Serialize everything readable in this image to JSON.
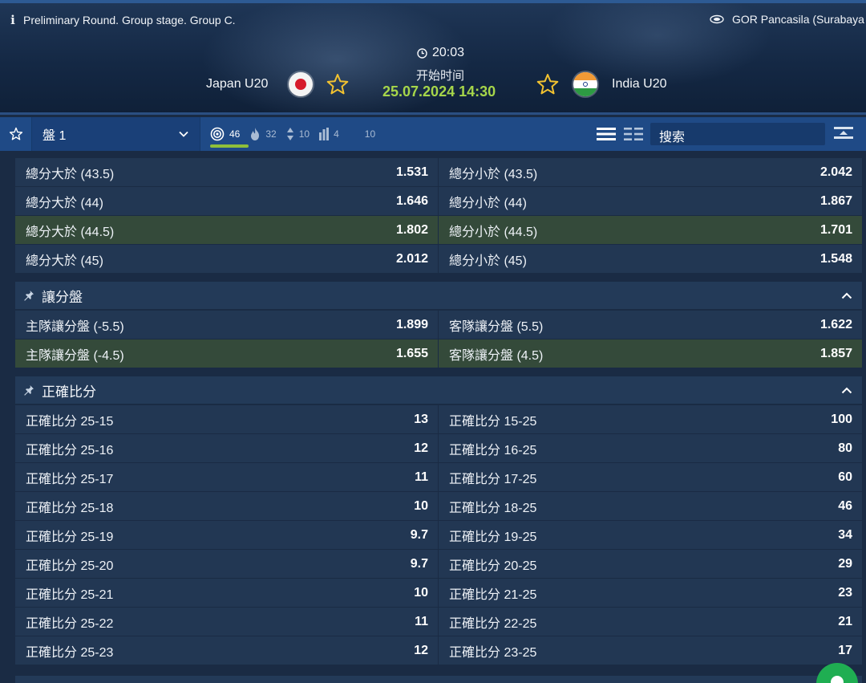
{
  "header": {
    "competition": "Preliminary Round. Group stage. Group C.",
    "venue": "GOR Pancasila (Surabaya",
    "time": "20:03",
    "start_label": "开始时间",
    "start_datetime": "25.07.2024 14:30",
    "home_team": "Japan U20",
    "away_team": "India U20"
  },
  "toolbar": {
    "market_select": "盤 1",
    "counters": [
      {
        "icon": "target-icon",
        "value": "46"
      },
      {
        "icon": "fire-icon",
        "value": "32"
      },
      {
        "icon": "updown-icon",
        "value": "10"
      },
      {
        "icon": "bars-icon",
        "value": "4"
      },
      {
        "icon": "none",
        "value": "10"
      }
    ],
    "search_placeholder": "搜索"
  },
  "totals": [
    {
      "over": "總分大於 (43.5)",
      "over_odd": "1.531",
      "under": "總分小於 (43.5)",
      "under_odd": "2.042",
      "highlight": false
    },
    {
      "over": "總分大於 (44)",
      "over_odd": "1.646",
      "under": "總分小於 (44)",
      "under_odd": "1.867",
      "highlight": false
    },
    {
      "over": "總分大於 (44.5)",
      "over_odd": "1.802",
      "under": "總分小於 (44.5)",
      "under_odd": "1.701",
      "highlight": true
    },
    {
      "over": "總分大於 (45)",
      "over_odd": "2.012",
      "under": "總分小於 (45)",
      "under_odd": "1.548",
      "highlight": false
    }
  ],
  "handicap": {
    "title": "讓分盤",
    "rows": [
      {
        "home": "主隊讓分盤 (-5.5)",
        "home_odd": "1.899",
        "away": "客隊讓分盤 (5.5)",
        "away_odd": "1.622",
        "highlight": false
      },
      {
        "home": "主隊讓分盤 (-4.5)",
        "home_odd": "1.655",
        "away": "客隊讓分盤 (4.5)",
        "away_odd": "1.857",
        "highlight": true
      }
    ]
  },
  "correct_score": {
    "title": "正確比分",
    "rows": [
      {
        "home": "正確比分 25-15",
        "home_odd": "13",
        "away": "正確比分 15-25",
        "away_odd": "100"
      },
      {
        "home": "正確比分 25-16",
        "home_odd": "12",
        "away": "正確比分 16-25",
        "away_odd": "80"
      },
      {
        "home": "正確比分 25-17",
        "home_odd": "11",
        "away": "正確比分 17-25",
        "away_odd": "60"
      },
      {
        "home": "正確比分 25-18",
        "home_odd": "10",
        "away": "正確比分 18-25",
        "away_odd": "46"
      },
      {
        "home": "正確比分 25-19",
        "home_odd": "9.7",
        "away": "正確比分 19-25",
        "away_odd": "34"
      },
      {
        "home": "正確比分 25-20",
        "home_odd": "9.7",
        "away": "正確比分 20-25",
        "away_odd": "29"
      },
      {
        "home": "正確比分 25-21",
        "home_odd": "10",
        "away": "正確比分 21-25",
        "away_odd": "23"
      },
      {
        "home": "正確比分 25-22",
        "home_odd": "11",
        "away": "正確比分 22-25",
        "away_odd": "21"
      },
      {
        "home": "正確比分 25-23",
        "home_odd": "12",
        "away": "正確比分 23-25",
        "away_odd": "17"
      }
    ]
  },
  "colors": {
    "toolbar": "#1f4a86",
    "row": "#223753",
    "row_highlight": "#344a3a",
    "date_green": "#a6d64a",
    "star_yellow": "#f2c230"
  }
}
